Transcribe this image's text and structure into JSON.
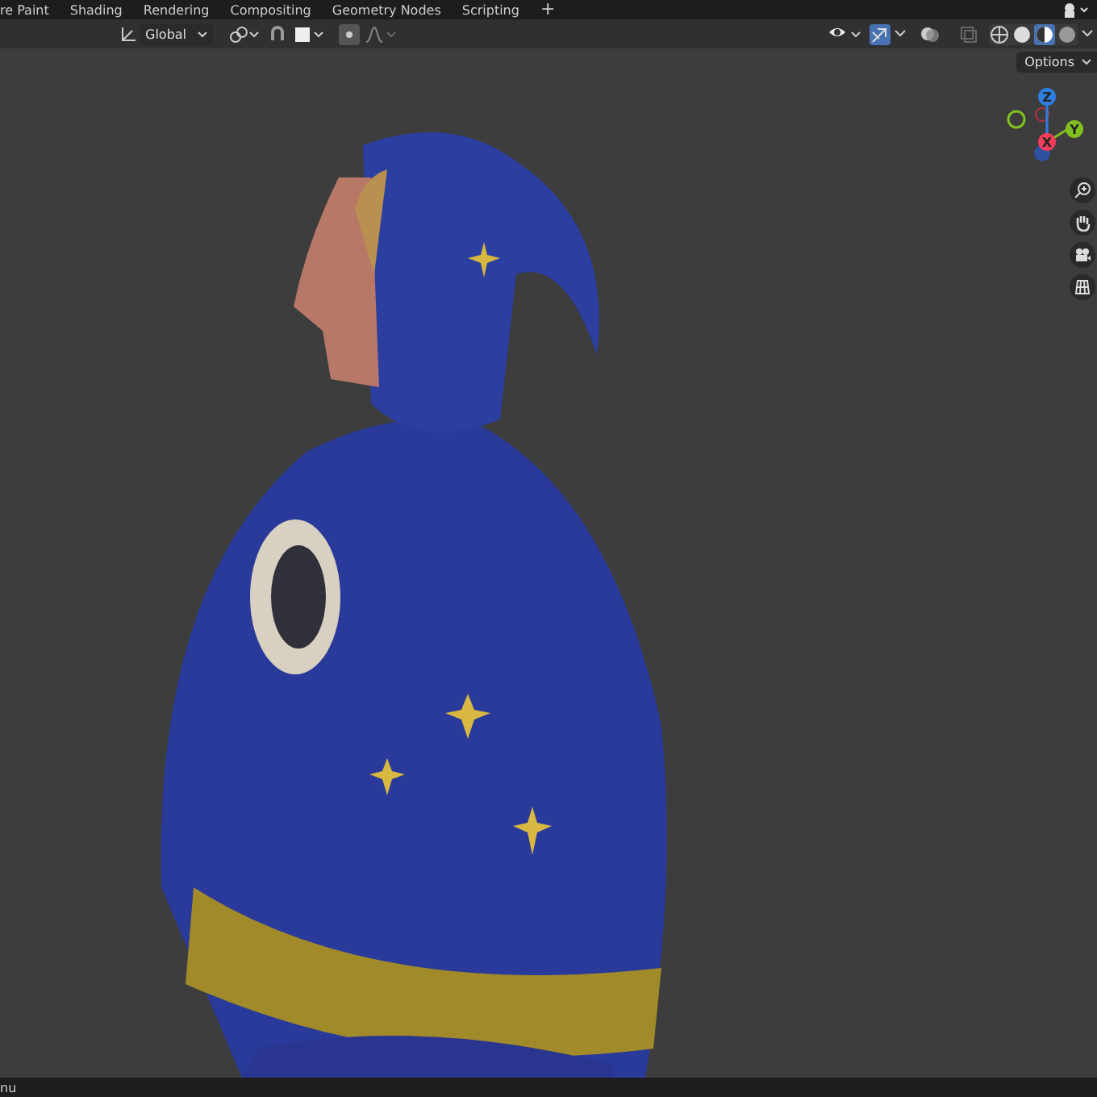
{
  "workspace_tabs": [
    {
      "label": "re Paint"
    },
    {
      "label": "Shading"
    },
    {
      "label": "Rendering"
    },
    {
      "label": "Compositing"
    },
    {
      "label": "Geometry Nodes"
    },
    {
      "label": "Scripting"
    }
  ],
  "add_workspace": "+",
  "header": {
    "transform_orientation": "Global",
    "gizmos_enabled": true,
    "shading_modes": [
      {
        "kind": "wireframe",
        "selected": false
      },
      {
        "kind": "solid",
        "selected": false
      },
      {
        "kind": "material",
        "selected": true
      },
      {
        "kind": "rendered",
        "selected": false
      }
    ]
  },
  "options": "Options",
  "navigation_gizmo": {
    "axes": [
      {
        "label": "Z"
      },
      {
        "label": "Y"
      },
      {
        "label": "X"
      }
    ]
  },
  "status_bar": {
    "text": "nu"
  }
}
